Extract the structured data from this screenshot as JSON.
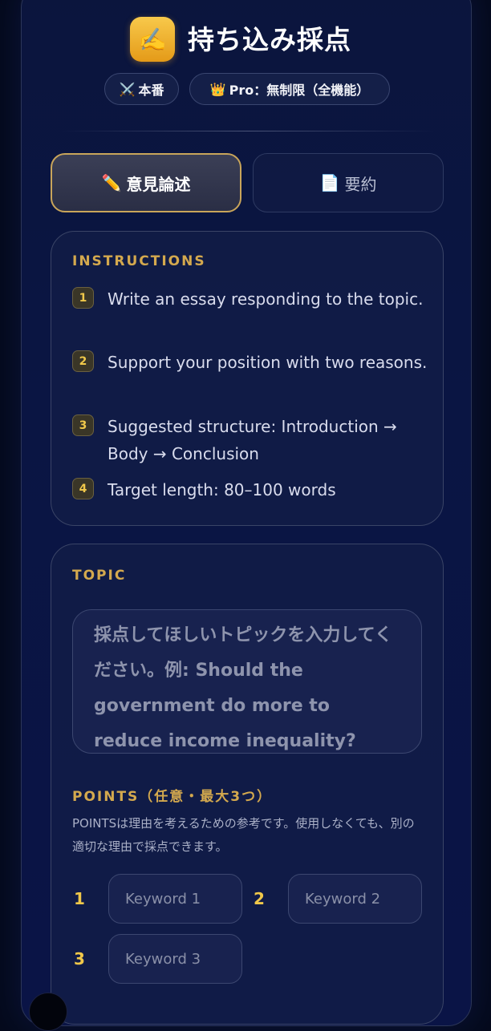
{
  "header": {
    "logo_icon": "✍️",
    "title": "持ち込み採点",
    "mode_pill": {
      "icon": "⚔️",
      "label": "本番"
    },
    "plan_pill": {
      "icon": "👑",
      "label": "Pro：無制限（全機能）"
    }
  },
  "tabs": [
    {
      "icon": "✏️",
      "label": "意見論述",
      "active": true
    },
    {
      "icon": "📄",
      "label": "要約",
      "active": false
    }
  ],
  "instructions": {
    "heading": "INSTRUCTIONS",
    "items": [
      {
        "num": "1",
        "text": "Write an essay responding to the topic."
      },
      {
        "num": "2",
        "text": "Support your position with two reasons."
      },
      {
        "num": "3",
        "text": "Suggested structure: Introduction → Body → Conclusion"
      },
      {
        "num": "4",
        "text": "Target length: 80–100 words"
      }
    ]
  },
  "topic": {
    "heading": "TOPIC",
    "placeholder": "採点してほしいトピックを入力してください。例: Should the government do more to reduce income inequality?"
  },
  "points": {
    "heading": "POINTS（任意・最大3つ）",
    "note": "POINTSは理由を考えるための参考です。使用しなくても、別の適切な理由で採点できます。",
    "keywords": [
      {
        "num": "1",
        "placeholder": "Keyword 1"
      },
      {
        "num": "2",
        "placeholder": "Keyword 2"
      },
      {
        "num": "3",
        "placeholder": "Keyword 3"
      }
    ]
  },
  "colors": {
    "accent_gold": "#d4a94e",
    "badge_gold": "#f0c84a",
    "background": "#0a1543"
  }
}
